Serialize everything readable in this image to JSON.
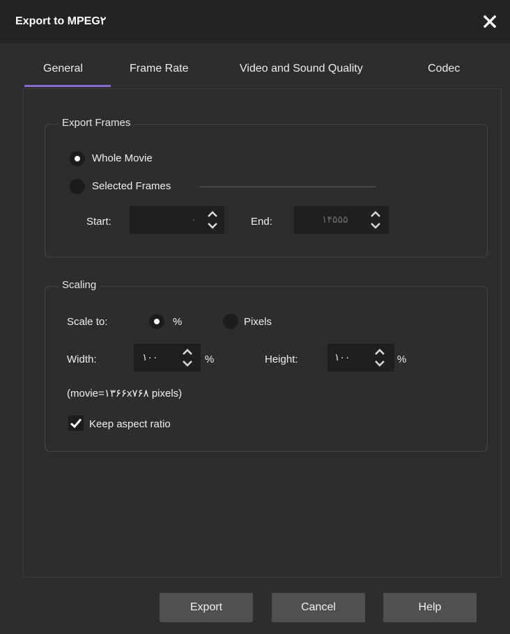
{
  "window": {
    "title": "Export to MPEG۲"
  },
  "tabs": [
    {
      "label": "General",
      "active": true
    },
    {
      "label": "Frame Rate",
      "active": false
    },
    {
      "label": "Video and Sound Quality",
      "active": false
    },
    {
      "label": "Codec",
      "active": false
    }
  ],
  "export_frames": {
    "legend": "Export Frames",
    "whole_movie_label": "Whole Movie",
    "whole_movie_checked": true,
    "selected_frames_label": "Selected Frames",
    "selected_frames_checked": false,
    "start_label": "Start:",
    "start_value": "۰",
    "end_label": "End:",
    "end_value": "۱۴۵۵۵"
  },
  "scaling": {
    "legend": "Scaling",
    "scale_to_label": "Scale to:",
    "percent_label": "%",
    "percent_checked": true,
    "pixels_label": "Pixels",
    "pixels_checked": false,
    "width_label": "Width:",
    "width_value": "۱۰۰",
    "width_unit": "%",
    "height_label": "Height:",
    "height_value": "۱۰۰",
    "height_unit": "%",
    "movie_info": "(movie=۱۳۶۶x۷۶۸ pixels)",
    "keep_aspect_label": "Keep aspect ratio",
    "keep_aspect_checked": true
  },
  "buttons": {
    "export": "Export",
    "cancel": "Cancel",
    "help": "Help"
  },
  "colors": {
    "accent": "#8e6bd1",
    "background": "#2d2d2d",
    "titlebar": "#232323"
  }
}
